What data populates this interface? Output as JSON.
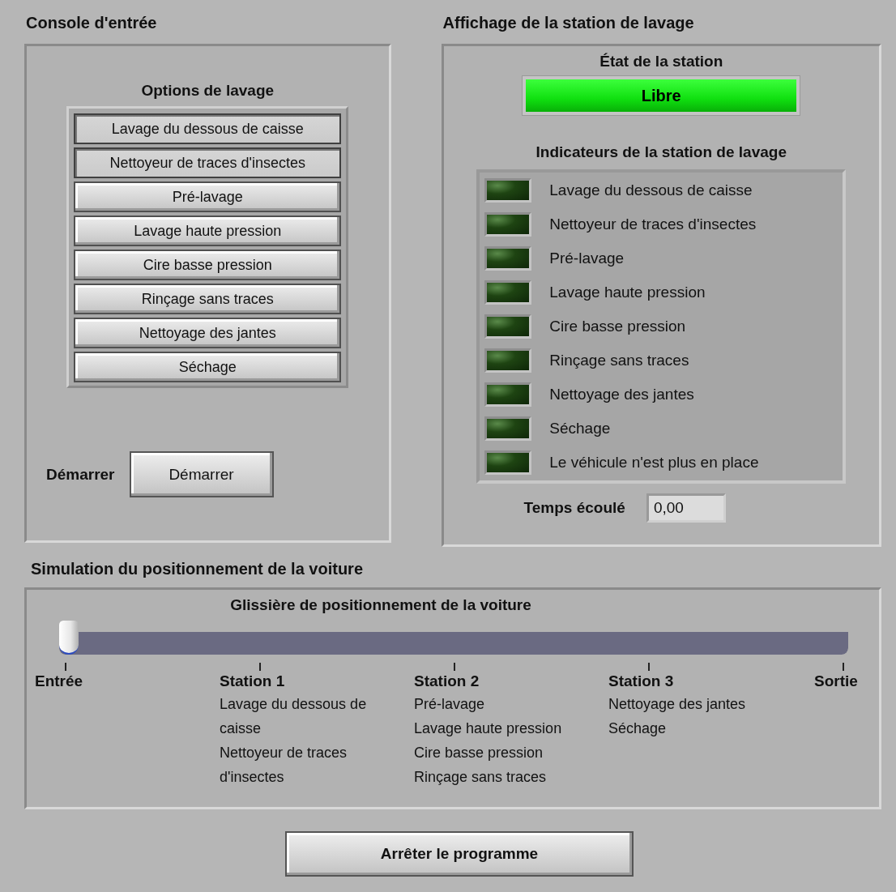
{
  "input_console": {
    "title": "Console d'entrée",
    "options_label": "Options de lavage",
    "options": [
      {
        "label": "Lavage du dessous de caisse",
        "selected": true
      },
      {
        "label": "Nettoyeur de traces d'insectes",
        "selected": true
      },
      {
        "label": "Pré-lavage",
        "selected": false
      },
      {
        "label": "Lavage haute pression",
        "selected": false
      },
      {
        "label": "Cire basse pression",
        "selected": false
      },
      {
        "label": "Rinçage sans traces",
        "selected": false
      },
      {
        "label": "Nettoyage des jantes",
        "selected": false
      },
      {
        "label": "Séchage",
        "selected": false
      }
    ],
    "start_label": "Démarrer",
    "start_button": "Démarrer"
  },
  "wash_display": {
    "title": "Affichage de la station de lavage",
    "status_label": "État de la station",
    "status": {
      "text": "Libre",
      "on": true
    },
    "indicators_label": "Indicateurs de la station de lavage",
    "indicators": [
      {
        "label": "Lavage du dessous de caisse",
        "on": false
      },
      {
        "label": "Nettoyeur de traces d'insectes",
        "on": false
      },
      {
        "label": "Pré-lavage",
        "on": false
      },
      {
        "label": "Lavage haute pression",
        "on": false
      },
      {
        "label": "Cire basse pression",
        "on": false
      },
      {
        "label": "Rinçage sans traces",
        "on": false
      },
      {
        "label": "Nettoyage des jantes",
        "on": false
      },
      {
        "label": "Séchage",
        "on": false
      },
      {
        "label": "Le véhicule n'est plus en place",
        "on": false
      }
    ],
    "elapsed_label": "Temps écoulé",
    "elapsed_value": "0,00"
  },
  "car_simulation": {
    "title": "Simulation du positionnement de la voiture",
    "slider_label": "Glissière de positionnement de la voiture",
    "slider": {
      "level": 0
    },
    "markers": [
      {
        "label": "Entrée"
      },
      {
        "label": "Station 1",
        "details": [
          "Lavage du dessous de caisse",
          "Nettoyeur de traces d'insectes"
        ]
      },
      {
        "label": "Station 2",
        "details": [
          "Pré-lavage",
          "Lavage haute pression",
          "Cire basse pression",
          "Rinçage sans traces"
        ]
      },
      {
        "label": "Station 3",
        "details": [
          "Nettoyage des jantes",
          "Séchage"
        ]
      },
      {
        "label": "Sortie"
      }
    ]
  },
  "stop_button": "Arrêter le programme"
}
